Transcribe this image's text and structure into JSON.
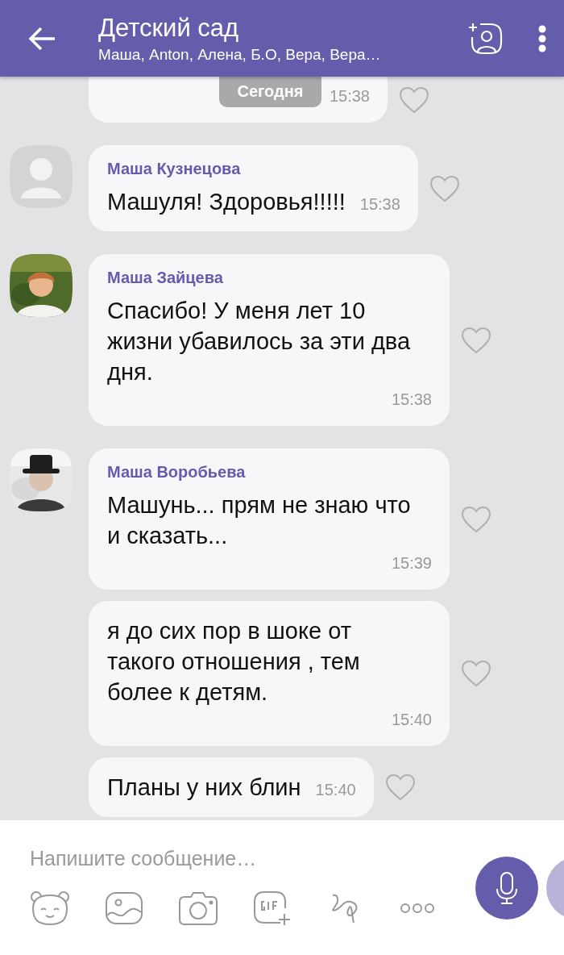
{
  "header": {
    "title": "Детский сад",
    "subtitle": "Маша, Anton, Алена, Б.О, Вера, Вера…"
  },
  "date_pill": "Сегодня",
  "messages": [
    {
      "kind": "cut",
      "time": "15:38",
      "liked": false
    },
    {
      "kind": "first",
      "avatar": {
        "kind": "placeholder"
      },
      "sender": "Маша Кузнецова",
      "text": "Машуля! Здоровья!!!!!",
      "time": "15:38",
      "liked": false
    },
    {
      "kind": "first",
      "sender": "Маша Зайцева",
      "text": "Спасибо! У меня лет 10 жизни убавилось за эти два дня.",
      "time": "15:38",
      "liked": false
    },
    {
      "kind": "first",
      "sender": "Маша Воробьева",
      "text": "Машунь... прям не знаю что и сказать...",
      "time": "15:39",
      "liked": false
    },
    {
      "kind": "next",
      "text": "я до сих пор в шоке от такого отношения , тем более к детям.",
      "time": "15:40",
      "liked": false
    },
    {
      "kind": "next",
      "text": "Планы у них блин",
      "time": "15:40",
      "liked": false
    }
  ],
  "composer": {
    "placeholder": "Напишите сообщение…"
  }
}
